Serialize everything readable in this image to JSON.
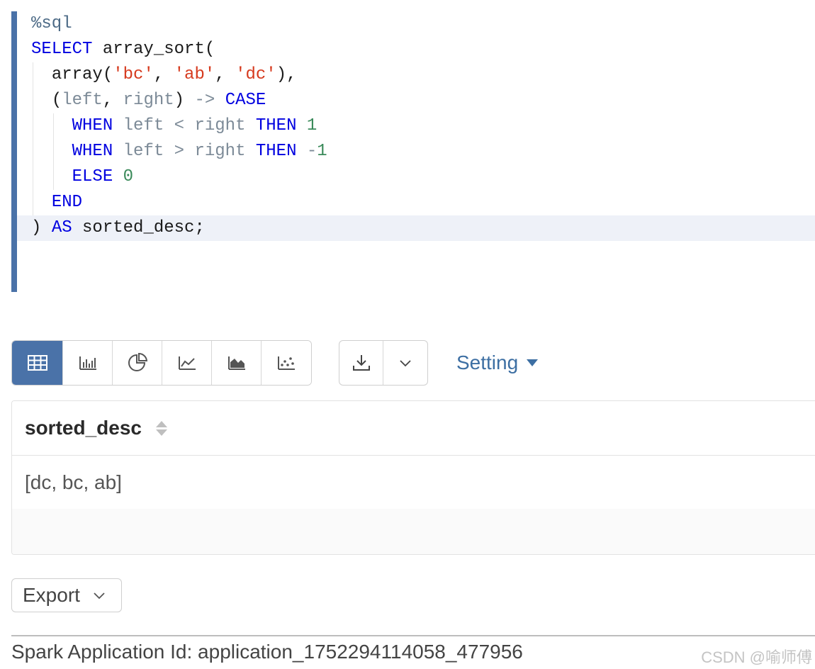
{
  "editor": {
    "lines": [
      {
        "indent": 0,
        "tokens": [
          {
            "t": "%sql",
            "c": "mag"
          }
        ]
      },
      {
        "indent": 0,
        "tokens": [
          {
            "t": "SELECT",
            "c": "kw"
          },
          {
            "t": " array_sort(",
            "c": "plain"
          }
        ]
      },
      {
        "indent": 1,
        "tokens": [
          {
            "t": "array(",
            "c": "plain"
          },
          {
            "t": "'bc'",
            "c": "str"
          },
          {
            "t": ", ",
            "c": "plain"
          },
          {
            "t": "'ab'",
            "c": "str"
          },
          {
            "t": ", ",
            "c": "plain"
          },
          {
            "t": "'dc'",
            "c": "str"
          },
          {
            "t": "),",
            "c": "plain"
          }
        ]
      },
      {
        "indent": 1,
        "tokens": [
          {
            "t": "(",
            "c": "plain"
          },
          {
            "t": "left",
            "c": "ident"
          },
          {
            "t": ", ",
            "c": "plain"
          },
          {
            "t": "right",
            "c": "ident"
          },
          {
            "t": ") ",
            "c": "plain"
          },
          {
            "t": "->",
            "c": "op"
          },
          {
            "t": " ",
            "c": "plain"
          },
          {
            "t": "CASE",
            "c": "kw"
          }
        ]
      },
      {
        "indent": 2,
        "tokens": [
          {
            "t": "WHEN",
            "c": "kw"
          },
          {
            "t": " ",
            "c": "plain"
          },
          {
            "t": "left",
            "c": "ident"
          },
          {
            "t": " ",
            "c": "plain"
          },
          {
            "t": "<",
            "c": "op"
          },
          {
            "t": " ",
            "c": "plain"
          },
          {
            "t": "right",
            "c": "ident"
          },
          {
            "t": " ",
            "c": "plain"
          },
          {
            "t": "THEN",
            "c": "kw"
          },
          {
            "t": " ",
            "c": "plain"
          },
          {
            "t": "1",
            "c": "num"
          }
        ]
      },
      {
        "indent": 2,
        "tokens": [
          {
            "t": "WHEN",
            "c": "kw"
          },
          {
            "t": " ",
            "c": "plain"
          },
          {
            "t": "left",
            "c": "ident"
          },
          {
            "t": " ",
            "c": "plain"
          },
          {
            "t": ">",
            "c": "op"
          },
          {
            "t": " ",
            "c": "plain"
          },
          {
            "t": "right",
            "c": "ident"
          },
          {
            "t": " ",
            "c": "plain"
          },
          {
            "t": "THEN",
            "c": "kw"
          },
          {
            "t": " ",
            "c": "plain"
          },
          {
            "t": "-",
            "c": "op"
          },
          {
            "t": "1",
            "c": "num"
          }
        ]
      },
      {
        "indent": 2,
        "tokens": [
          {
            "t": "ELSE",
            "c": "kw"
          },
          {
            "t": " ",
            "c": "plain"
          },
          {
            "t": "0",
            "c": "num"
          }
        ]
      },
      {
        "indent": 1,
        "tokens": [
          {
            "t": "END",
            "c": "kw"
          }
        ]
      },
      {
        "indent": 0,
        "active": true,
        "tokens": [
          {
            "t": ") ",
            "c": "plain"
          },
          {
            "t": "AS",
            "c": "kw"
          },
          {
            "t": " sorted_desc;",
            "c": "plain"
          }
        ]
      }
    ]
  },
  "toolbar": {
    "viz_buttons": [
      {
        "name": "table-view-button",
        "icon": "table-icon",
        "active": true
      },
      {
        "name": "bar-chart-button",
        "icon": "bar-chart-icon",
        "active": false
      },
      {
        "name": "pie-chart-button",
        "icon": "pie-chart-icon",
        "active": false
      },
      {
        "name": "line-chart-button",
        "icon": "line-chart-icon",
        "active": false
      },
      {
        "name": "area-chart-button",
        "icon": "area-chart-icon",
        "active": false
      },
      {
        "name": "scatter-chart-button",
        "icon": "scatter-chart-icon",
        "active": false
      }
    ],
    "download_icon": "download-icon",
    "dropdown_icon": "chevron-down-icon",
    "setting_label": "Setting"
  },
  "table": {
    "columns": [
      "sorted_desc"
    ],
    "rows": [
      [
        "[dc, bc, ab]"
      ]
    ]
  },
  "export": {
    "label": "Export"
  },
  "footer": {
    "app_id": "Spark Application Id: application_1752294114058_477956",
    "watermark": "CSDN @喻师傅"
  },
  "colors": {
    "accent": "#4a72a8",
    "link": "#3d6fa3",
    "keyword": "#0000e0",
    "string": "#d63a1e",
    "number": "#3a8a5a"
  }
}
